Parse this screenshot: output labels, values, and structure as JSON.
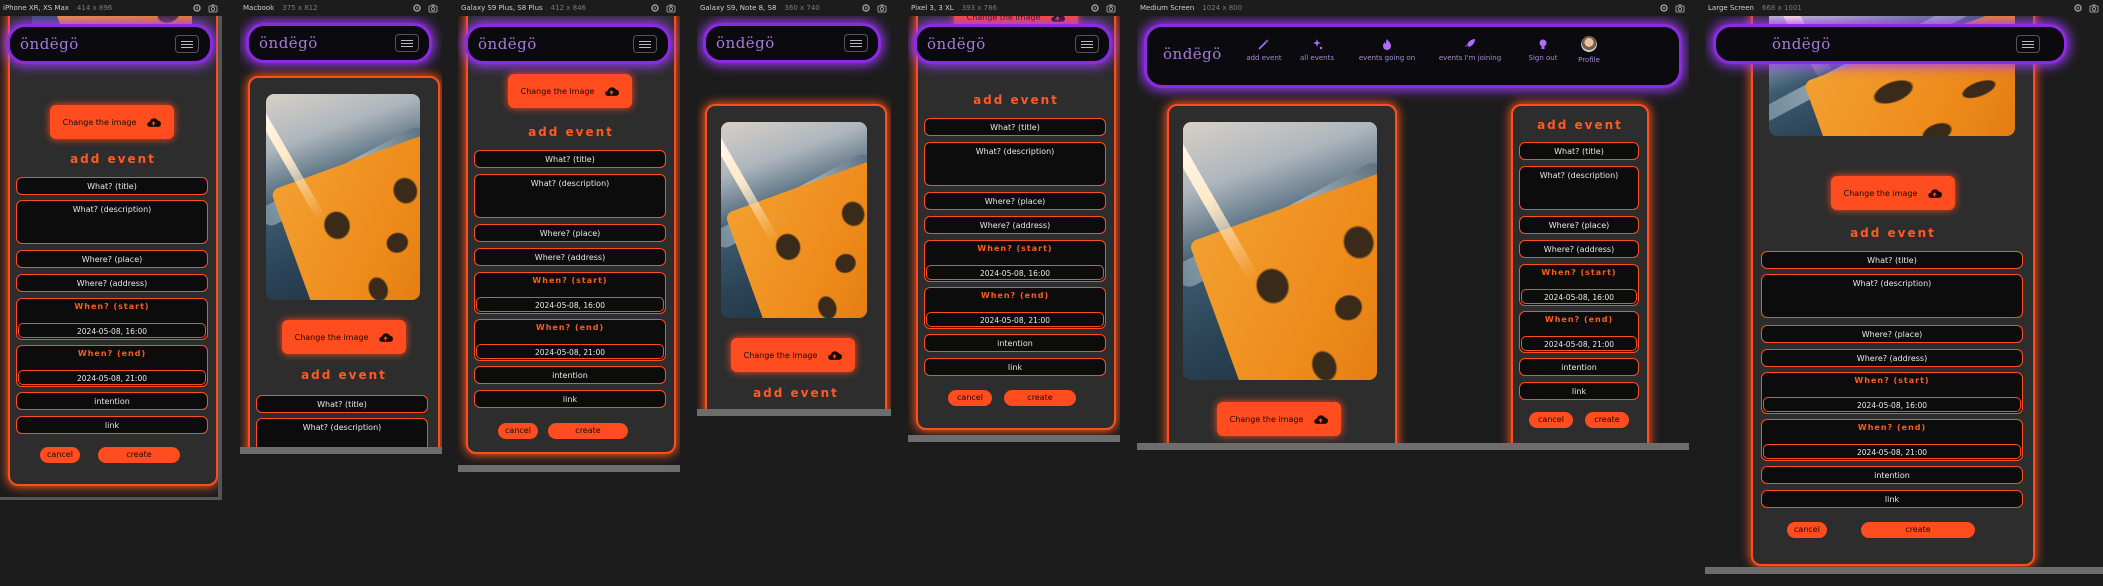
{
  "colors": {
    "accent": "#ff4d1f",
    "nav_border": "#8a2be2",
    "background": "#1c1c1c",
    "brand": "#a77bd8"
  },
  "app": {
    "brand": "öndëgö"
  },
  "devices": [
    {
      "name": "iPhone XR, XS Max",
      "size": "414 x 896"
    },
    {
      "name": "Macbook",
      "size": "375 x 812"
    },
    {
      "name": "Galaxy S9 Plus, S8 Plus",
      "size": "412 x 846"
    },
    {
      "name": "Galaxy S9, Note 8, S8",
      "size": "360 x 740"
    },
    {
      "name": "Pixel 3, 3 XL",
      "size": "393 x 786"
    },
    {
      "name": "Medium Screen",
      "size": "1024 x 800"
    },
    {
      "name": "Large Screen",
      "size": "668 x 1001"
    }
  ],
  "form": {
    "change_image": "Change the image",
    "heading": "add event",
    "title_placeholder": "What? (title)",
    "description_placeholder": "What? (description)",
    "place_placeholder": "Where? (place)",
    "address_placeholder": "Where? (address)",
    "start_label": "When? (start)",
    "start_value": "2024-05-08, 16:00",
    "end_label": "When? (end)",
    "end_value": "2024-05-08, 21:00",
    "intention_placeholder": "intention",
    "link_placeholder": "link",
    "cancel": "cancel",
    "create": "create"
  },
  "nav": {
    "items": [
      {
        "label": "add event",
        "icon": "magic-wand-icon"
      },
      {
        "label": "all events",
        "icon": "sparkles-icon"
      },
      {
        "label": "events going on",
        "icon": "fire-icon"
      },
      {
        "label": "events I'm joining",
        "icon": "rocket-icon"
      },
      {
        "label": "Sign out",
        "icon": "lightbulb-icon"
      },
      {
        "label": "Profile",
        "icon": "avatar"
      }
    ]
  }
}
